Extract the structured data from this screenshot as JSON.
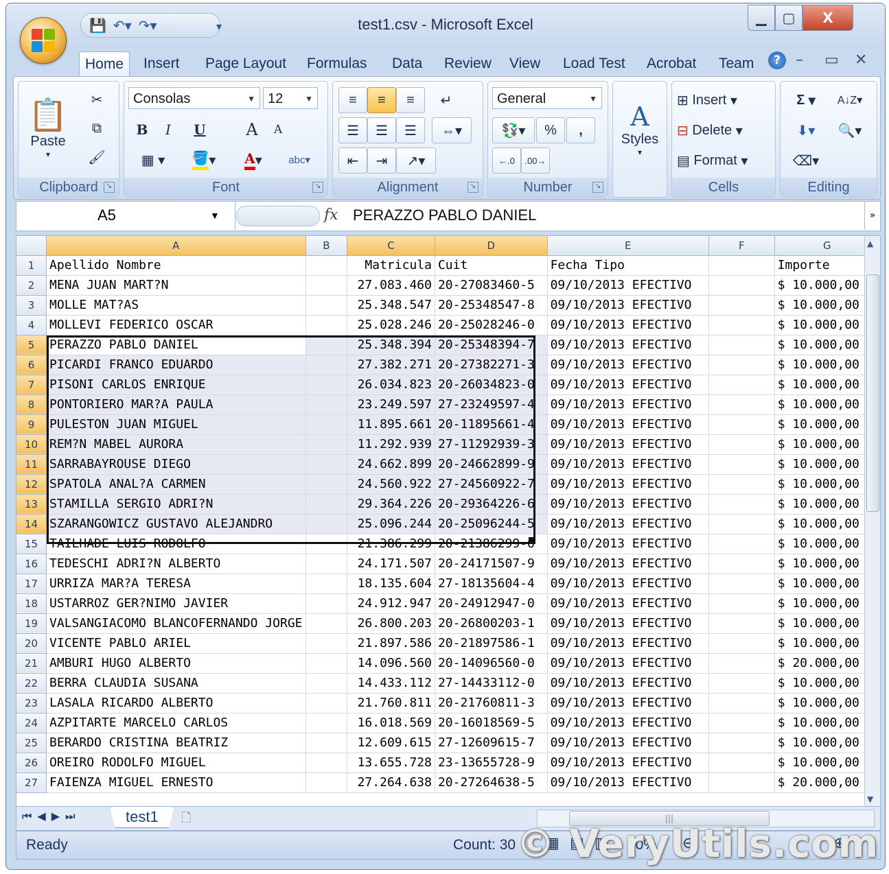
{
  "window": {
    "title": "test1.csv - Microsoft Excel",
    "minimize": "▁",
    "maximize": "▢",
    "close": "X"
  },
  "qat": {
    "save": "💾",
    "undo": "↶▾",
    "redo": "↷▾",
    "customize": "▾"
  },
  "tabs": [
    "Home",
    "Insert",
    "Page Layout",
    "Formulas",
    "Data",
    "Review",
    "View",
    "Load Test",
    "Acrobat",
    "Team"
  ],
  "ribbon": {
    "clipboard": {
      "label": "Clipboard",
      "paste": "Paste"
    },
    "font": {
      "label": "Font",
      "name": "Consolas",
      "size": "12",
      "bold": "B",
      "italic": "I",
      "underline": "U",
      "grow": "A",
      "shrink": "A",
      "color_letter": "A",
      "abc": "abc"
    },
    "alignment": {
      "label": "Alignment"
    },
    "number": {
      "label": "Number",
      "format": "General",
      "percent": "%",
      "comma": ","
    },
    "styles": {
      "label": "Styles"
    },
    "cells": {
      "label": "Cells",
      "insert": "Insert",
      "delete": "Delete",
      "format": "Format"
    },
    "editing": {
      "label": "Editing",
      "sum": "Σ"
    }
  },
  "formula_bar": {
    "name_box": "A5",
    "fx": "fx",
    "content": "PERAZZO PABLO DANIEL"
  },
  "sheet": {
    "columns": [
      "A",
      "B",
      "C",
      "D",
      "E",
      "F",
      "G"
    ],
    "rows": [
      {
        "n": "1",
        "a": "Apellido Nombre",
        "c": "Matricula",
        "d": "Cuit",
        "e": "Fecha Tipo",
        "g": "Importe"
      },
      {
        "n": "2",
        "a": "MENA JUAN MART?N",
        "c": "27.083.460",
        "d": "20-27083460-5",
        "e": "09/10/2013 EFECTIVO",
        "g": "$ 10.000,00"
      },
      {
        "n": "3",
        "a": "MOLLE MAT?AS",
        "c": "25.348.547",
        "d": "20-25348547-8",
        "e": "09/10/2013 EFECTIVO",
        "g": "$ 10.000,00"
      },
      {
        "n": "4",
        "a": "MOLLEVI FEDERICO OSCAR",
        "c": "25.028.246",
        "d": "20-25028246-0",
        "e": "09/10/2013 EFECTIVO",
        "g": "$ 10.000,00"
      },
      {
        "n": "5",
        "a": "PERAZZO PABLO DANIEL",
        "c": "25.348.394",
        "d": "20-25348394-7",
        "e": "09/10/2013 EFECTIVO",
        "g": "$ 10.000,00"
      },
      {
        "n": "6",
        "a": "PICARDI FRANCO EDUARDO",
        "c": "27.382.271",
        "d": "20-27382271-3",
        "e": "09/10/2013 EFECTIVO",
        "g": "$ 10.000,00"
      },
      {
        "n": "7",
        "a": "PISONI CARLOS ENRIQUE",
        "c": "26.034.823",
        "d": "20-26034823-0",
        "e": "09/10/2013 EFECTIVO",
        "g": "$ 10.000,00"
      },
      {
        "n": "8",
        "a": "PONTORIERO MAR?A PAULA",
        "c": "23.249.597",
        "d": "27-23249597-4",
        "e": "09/10/2013 EFECTIVO",
        "g": "$ 10.000,00"
      },
      {
        "n": "9",
        "a": "PULESTON JUAN MIGUEL",
        "c": "11.895.661",
        "d": "20-11895661-4",
        "e": "09/10/2013 EFECTIVO",
        "g": "$ 10.000,00"
      },
      {
        "n": "10",
        "a": "REM?N MABEL AURORA",
        "c": "11.292.939",
        "d": "27-11292939-3",
        "e": "09/10/2013 EFECTIVO",
        "g": "$ 10.000,00"
      },
      {
        "n": "11",
        "a": "SARRABAYROUSE DIEGO",
        "c": "24.662.899",
        "d": "20-24662899-9",
        "e": "09/10/2013 EFECTIVO",
        "g": "$ 10.000,00"
      },
      {
        "n": "12",
        "a": "SPATOLA ANAL?A CARMEN",
        "c": "24.560.922",
        "d": "27-24560922-7",
        "e": "09/10/2013 EFECTIVO",
        "g": "$ 10.000,00"
      },
      {
        "n": "13",
        "a": "STAMILLA SERGIO ADRI?N",
        "c": "29.364.226",
        "d": "20-29364226-6",
        "e": "09/10/2013 EFECTIVO",
        "g": "$ 10.000,00"
      },
      {
        "n": "14",
        "a": "SZARANGOWICZ GUSTAVO ALEJANDRO",
        "c": "25.096.244",
        "d": "20-25096244-5",
        "e": "09/10/2013 EFECTIVO",
        "g": "$ 10.000,00"
      },
      {
        "n": "15",
        "a": "TAILHADE LUIS RODOLFO",
        "c": "21.386.299",
        "d": "20-21386299-6",
        "e": "09/10/2013 EFECTIVO",
        "g": "$ 10.000,00"
      },
      {
        "n": "16",
        "a": "TEDESCHI ADRI?N ALBERTO",
        "c": "24.171.507",
        "d": "20-24171507-9",
        "e": "09/10/2013 EFECTIVO",
        "g": "$ 10.000,00"
      },
      {
        "n": "17",
        "a": "URRIZA MAR?A TERESA",
        "c": "18.135.604",
        "d": "27-18135604-4",
        "e": "09/10/2013 EFECTIVO",
        "g": "$ 10.000,00"
      },
      {
        "n": "18",
        "a": "USTARROZ GER?NIMO JAVIER",
        "c": "24.912.947",
        "d": "20-24912947-0",
        "e": "09/10/2013 EFECTIVO",
        "g": "$ 10.000,00"
      },
      {
        "n": "19",
        "a": "VALSANGIACOMO BLANCOFERNANDO JORGE",
        "c": "26.800.203",
        "d": "20-26800203-1",
        "e": "09/10/2013 EFECTIVO",
        "g": "$ 10.000,00"
      },
      {
        "n": "20",
        "a": "VICENTE PABLO ARIEL",
        "c": "21.897.586",
        "d": "20-21897586-1",
        "e": "09/10/2013 EFECTIVO",
        "g": "$ 10.000,00"
      },
      {
        "n": "21",
        "a": "AMBURI HUGO ALBERTO",
        "c": "14.096.560",
        "d": "20-14096560-0",
        "e": "09/10/2013 EFECTIVO",
        "g": "$ 20.000,00"
      },
      {
        "n": "22",
        "a": "BERRA CLAUDIA SUSANA",
        "c": "14.433.112",
        "d": "27-14433112-0",
        "e": "09/10/2013 EFECTIVO",
        "g": "$ 10.000,00"
      },
      {
        "n": "23",
        "a": "LASALA RICARDO ALBERTO",
        "c": "21.760.811",
        "d": "20-21760811-3",
        "e": "09/10/2013 EFECTIVO",
        "g": "$ 10.000,00"
      },
      {
        "n": "24",
        "a": "AZPITARTE MARCELO CARLOS",
        "c": "16.018.569",
        "d": "20-16018569-5",
        "e": "09/10/2013 EFECTIVO",
        "g": "$ 10.000,00"
      },
      {
        "n": "25",
        "a": "BERARDO CRISTINA BEATRIZ",
        "c": "12.609.615",
        "d": "27-12609615-7",
        "e": "09/10/2013 EFECTIVO",
        "g": "$ 10.000,00"
      },
      {
        "n": "26",
        "a": "OREIRO RODOLFO MIGUEL",
        "c": "13.655.728",
        "d": "23-13655728-9",
        "e": "09/10/2013 EFECTIVO",
        "g": "$ 10.000,00"
      },
      {
        "n": "27",
        "a": "FAIENZA MIGUEL ERNESTO",
        "c": "27.264.638",
        "d": "20-27264638-5",
        "e": "09/10/2013 EFECTIVO",
        "g": "$ 20.000,00"
      }
    ],
    "selection": {
      "first_row": 5,
      "last_row": 14
    }
  },
  "sheet_tabs": {
    "active": "test1"
  },
  "status": {
    "mode": "Ready",
    "count": "Count: 30",
    "zoom": "70%"
  },
  "watermark": "© VeryUtils.com"
}
